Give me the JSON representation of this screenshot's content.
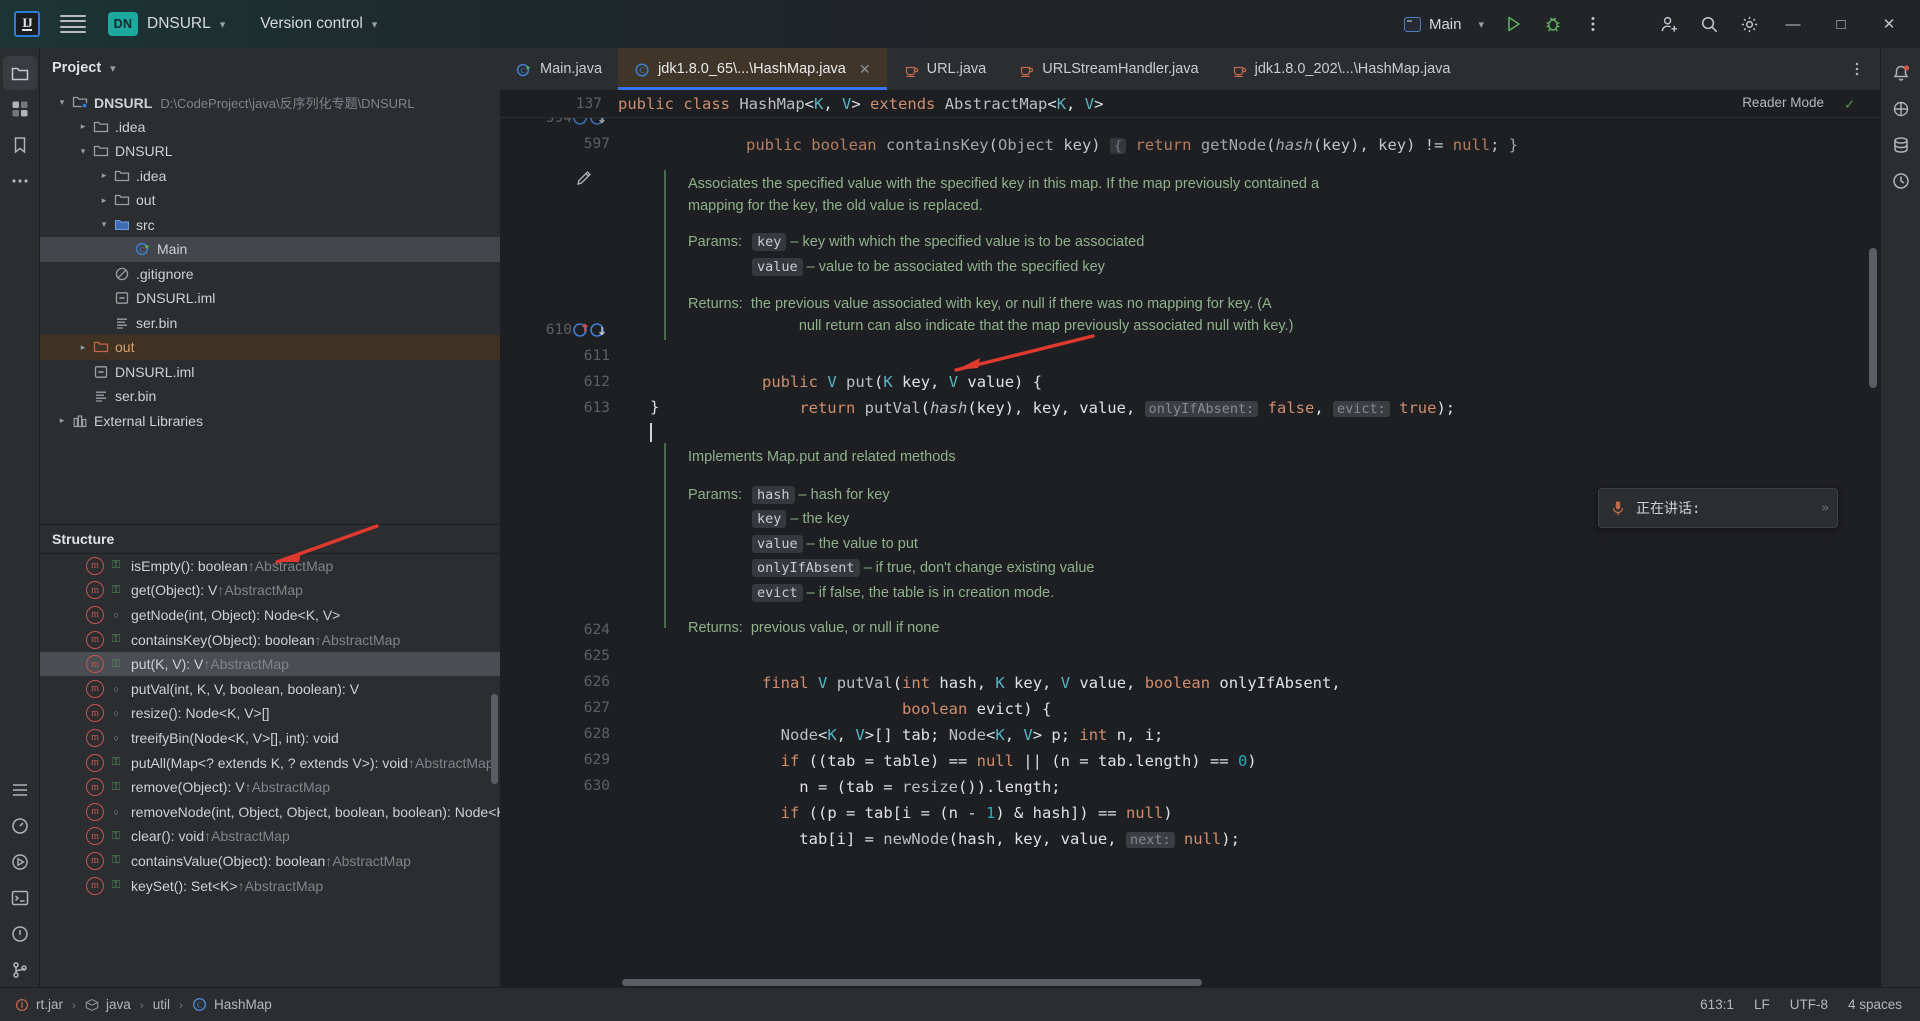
{
  "titlebar": {
    "logo": "IJ",
    "menu_icon": "hamburger-icon",
    "project_badge": "DN",
    "project_name": "DNSURL",
    "version_control": "Version control",
    "run_config": "Main",
    "run_icon": "run-icon",
    "debug_icon": "debug-icon",
    "more_icon": "more-vertical-icon",
    "account_icon": "account-add-icon",
    "search_icon": "search-icon",
    "settings_icon": "gear-icon",
    "minimize": "—",
    "maximize": "□",
    "close": "✕"
  },
  "left_rail": [
    {
      "name": "project-tool-icon",
      "glyph": "folder"
    },
    {
      "name": "commit-tool-icon",
      "glyph": "grid"
    },
    {
      "name": "bookmarks-tool-icon",
      "glyph": "bookmark"
    },
    {
      "name": "more-tools-icon",
      "glyph": "dots"
    }
  ],
  "left_rail_bottom": [
    {
      "name": "structure-tool-icon",
      "glyph": "list"
    },
    {
      "name": "profiler-tool-icon",
      "glyph": "gauge"
    },
    {
      "name": "run-tool-icon",
      "glyph": "play"
    },
    {
      "name": "terminal-tool-icon",
      "glyph": "terminal"
    },
    {
      "name": "problems-tool-icon",
      "glyph": "exclaim"
    },
    {
      "name": "git-tool-icon",
      "glyph": "branch"
    }
  ],
  "right_rail": [
    {
      "name": "notifications-icon",
      "glyph": "bell"
    },
    {
      "name": "ai-assistant-icon",
      "glyph": "ai"
    },
    {
      "name": "database-icon",
      "glyph": "db"
    },
    {
      "name": "history-icon",
      "glyph": "clock"
    }
  ],
  "project_panel": {
    "title": "Project",
    "chevron": "⌄",
    "tree": [
      {
        "depth": 0,
        "arrow": "down",
        "icon": "module-folder-icon",
        "label": "DNSURL",
        "bold": true,
        "path": "D:\\CodeProject\\java\\反序列化专题\\DNSURL",
        "state": "normal"
      },
      {
        "depth": 1,
        "arrow": "right",
        "icon": "folder-icon",
        "label": ".idea",
        "state": "normal"
      },
      {
        "depth": 1,
        "arrow": "down",
        "icon": "folder-icon",
        "label": "DNSURL",
        "state": "normal"
      },
      {
        "depth": 2,
        "arrow": "right",
        "icon": "folder-icon",
        "label": ".idea",
        "state": "normal"
      },
      {
        "depth": 2,
        "arrow": "right",
        "icon": "folder-icon",
        "label": "out",
        "state": "normal"
      },
      {
        "depth": 2,
        "arrow": "down",
        "icon": "source-folder-icon",
        "label": "src",
        "state": "normal"
      },
      {
        "depth": 3,
        "arrow": "none",
        "icon": "java-class-run-icon",
        "label": "Main",
        "state": "selected"
      },
      {
        "depth": 2,
        "arrow": "none",
        "icon": "gitignore-icon",
        "label": ".gitignore",
        "state": "normal"
      },
      {
        "depth": 2,
        "arrow": "none",
        "icon": "iml-icon",
        "label": "DNSURL.iml",
        "state": "normal"
      },
      {
        "depth": 2,
        "arrow": "none",
        "icon": "binary-file-icon",
        "label": "ser.bin",
        "state": "normal"
      },
      {
        "depth": 1,
        "arrow": "right",
        "icon": "excluded-folder-icon",
        "label": "out",
        "state": "excluded"
      },
      {
        "depth": 1,
        "arrow": "none",
        "icon": "iml-icon",
        "label": "DNSURL.iml",
        "state": "normal"
      },
      {
        "depth": 1,
        "arrow": "none",
        "icon": "binary-file-icon",
        "label": "ser.bin",
        "state": "normal"
      },
      {
        "depth": 0,
        "arrow": "right",
        "icon": "external-libraries-icon",
        "label": "External Libraries",
        "state": "normal"
      }
    ]
  },
  "structure_panel": {
    "title": "Structure",
    "items": [
      {
        "label": "isEmpty(): boolean",
        "owner": "↑AbstractMap",
        "vis": "public",
        "state": "normal"
      },
      {
        "label": "get(Object): V",
        "owner": "↑AbstractMap",
        "vis": "public",
        "state": "normal"
      },
      {
        "label": "getNode(int, Object): Node<K, V>",
        "owner": "",
        "vis": "package",
        "state": "normal"
      },
      {
        "label": "containsKey(Object): boolean",
        "owner": "↑AbstractMap",
        "vis": "public",
        "state": "normal"
      },
      {
        "label": "put(K, V): V",
        "owner": "↑AbstractMap",
        "vis": "public",
        "state": "selected"
      },
      {
        "label": "putVal(int, K, V, boolean, boolean): V",
        "owner": "",
        "vis": "package",
        "state": "normal"
      },
      {
        "label": "resize(): Node<K, V>[]",
        "owner": "",
        "vis": "package",
        "state": "normal"
      },
      {
        "label": "treeifyBin(Node<K, V>[], int): void",
        "owner": "",
        "vis": "package",
        "state": "normal"
      },
      {
        "label": "putAll(Map<? extends K, ? extends V>): void",
        "owner": "↑AbstractMap",
        "vis": "public",
        "state": "normal"
      },
      {
        "label": "remove(Object): V",
        "owner": "↑AbstractMap",
        "vis": "public",
        "state": "normal"
      },
      {
        "label": "removeNode(int, Object, Object, boolean, boolean): Node<K, V>",
        "owner": "",
        "vis": "package",
        "state": "normal"
      },
      {
        "label": "clear(): void",
        "owner": "↑AbstractMap",
        "vis": "public",
        "state": "normal"
      },
      {
        "label": "containsValue(Object): boolean",
        "owner": "↑AbstractMap",
        "vis": "public",
        "state": "normal"
      },
      {
        "label": "keySet(): Set<K>",
        "owner": "↑AbstractMap",
        "vis": "public",
        "state": "normal"
      }
    ]
  },
  "editor": {
    "tabs": [
      {
        "label": "Main.java",
        "icon": "java-class-run-icon",
        "active": false,
        "closable": false
      },
      {
        "label": "jdk1.8.0_65\\...\\HashMap.java",
        "icon": "java-class-readonly-icon",
        "active": true,
        "closable": true
      },
      {
        "label": "URL.java",
        "icon": "java-file-icon",
        "active": false,
        "closable": false
      },
      {
        "label": "URLStreamHandler.java",
        "icon": "java-file-icon",
        "active": false,
        "closable": false
      },
      {
        "label": "jdk1.8.0_202\\...\\HashMap.java",
        "icon": "java-file-icon",
        "active": false,
        "closable": false
      }
    ],
    "tab_options_icon": "more-vertical-icon",
    "sticky_header": {
      "line_number": "137",
      "text": "public class HashMap<K, V> extends AbstractMap<K, V>"
    },
    "reader_mode_label": "Reader Mode",
    "reader_mode_check": "✓",
    "clipped_line": {
      "line_number": "594",
      "text": "public boolean containsKey(Object key) { return getNode(hash(key), key) != null; }"
    },
    "lines": [
      {
        "num": "597",
        "text": ""
      },
      {
        "num": "610",
        "text": "public V put(K key, V value) {",
        "marks": "override-up, implement-down"
      },
      {
        "num": "611",
        "text": "    return putVal(hash(key), key, value, onlyIfAbsent: false, evict: true);"
      },
      {
        "num": "612",
        "text": "}"
      },
      {
        "num": "613",
        "text": "",
        "caret": true
      },
      {
        "num": "624",
        "text": "final V putVal(int hash, K key, V value, boolean onlyIfAbsent,"
      },
      {
        "num": "625",
        "text": "               boolean evict) {"
      },
      {
        "num": "626",
        "text": "    Node<K, V>[] tab; Node<K, V> p; int n, i;"
      },
      {
        "num": "627",
        "text": "    if ((tab = table) == null || (n = tab.length) == 0)"
      },
      {
        "num": "628",
        "text": "        n = (tab = resize()).length;"
      },
      {
        "num": "629",
        "text": "    if ((p = tab[i = (n - 1) & hash]) == null)"
      },
      {
        "num": "630",
        "text": "        tab[i] = newNode(hash, key, value, next: null);"
      }
    ],
    "doc1": {
      "summary": "Associates the specified value with the specified key in this map. If the map previously contained a mapping for the key, the old value is replaced.",
      "params_label": "Params:",
      "params": [
        {
          "name": "key",
          "desc": "– key with which the specified value is to be associated"
        },
        {
          "name": "value",
          "desc": "– value to be associated with the specified key"
        }
      ],
      "returns_label": "Returns:",
      "returns_line1": "the previous value associated with key, or null if there was no mapping for key. (A",
      "returns_line2": "null return can also indicate that the map previously associated null with key.)"
    },
    "doc2": {
      "summary": "Implements Map.put and related methods",
      "params_label": "Params:",
      "params": [
        {
          "name": "hash",
          "desc": "– hash for key"
        },
        {
          "name": "key",
          "desc": "– the key"
        },
        {
          "name": "value",
          "desc": "– the value to put"
        },
        {
          "name": "onlyIfAbsent",
          "desc": "– if true, don't change existing value"
        },
        {
          "name": "evict",
          "desc": "– if false, the table is in creation mode."
        }
      ],
      "returns_label": "Returns:",
      "returns_line1": "previous value, or null if none"
    },
    "edit_pencil_icon": "pencil-icon"
  },
  "speech_widget": {
    "icon": "microphone-icon",
    "text": "正在讲话:",
    "corner": "»"
  },
  "status_bar": {
    "breadcrumbs": [
      {
        "icon": "jar-icon",
        "label": "rt.jar"
      },
      {
        "icon": "package-icon",
        "label": "java"
      },
      {
        "icon": "",
        "label": "util"
      },
      {
        "icon": "java-class-icon",
        "label": "HashMap"
      }
    ],
    "separator": "›",
    "caret_position": "613:1",
    "line_separator": "LF",
    "encoding": "UTF-8",
    "indent": "4 spaces"
  },
  "colors": {
    "accent_blue": "#3574f0",
    "teal_badge": "#1ea8a0",
    "active_tab_bg": "#3f3528",
    "excluded_folder": "#3f3222",
    "doc_green": "#91b08e",
    "annotation_red": "#e03a2f"
  }
}
